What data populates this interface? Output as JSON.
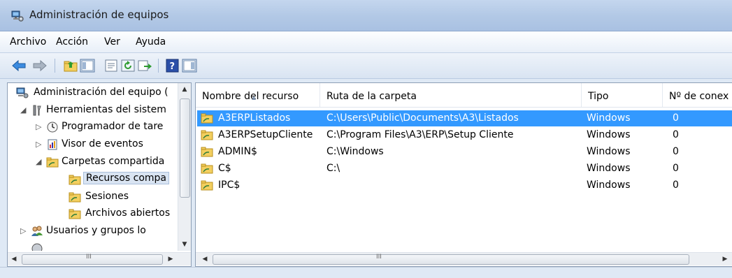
{
  "window": {
    "title": "Administración de equipos"
  },
  "menu": [
    "Archivo",
    "Acción",
    "Ver",
    "Ayuda"
  ],
  "toolbar_icons": [
    "back-arrow-icon",
    "forward-arrow-icon",
    "up-folder-icon",
    "show-hide-tree-icon",
    "properties-icon",
    "refresh-icon",
    "export-list-icon",
    "help-icon",
    "show-hide-action-pane-icon"
  ],
  "tree": {
    "root": "Administración del equipo (",
    "system_tools": "Herramientas del sistem",
    "task_scheduler": "Programador de tare",
    "event_viewer": "Visor de eventos",
    "shared_folders": "Carpetas compartida",
    "shares": "Recursos compa",
    "sessions": "Sesiones",
    "open_files": "Archivos abiertos",
    "local_users": "Usuarios y grupos lo"
  },
  "table": {
    "columns": [
      "Nombre del recurso",
      "Ruta de la carpeta",
      "Tipo",
      "Nº de conex"
    ],
    "rows": [
      {
        "name": "A3ERPListados",
        "path": "C:\\Users\\Public\\Documents\\A3\\Listados",
        "type": "Windows",
        "connections": "0",
        "selected": true
      },
      {
        "name": "A3ERPSetupCliente",
        "path": "C:\\Program Files\\A3\\ERP\\Setup Cliente",
        "type": "Windows",
        "connections": "0",
        "selected": false
      },
      {
        "name": "ADMIN$",
        "path": "C:\\Windows",
        "type": "Windows",
        "connections": "0",
        "selected": false
      },
      {
        "name": "C$",
        "path": "C:\\",
        "type": "Windows",
        "connections": "0",
        "selected": false
      },
      {
        "name": "IPC$",
        "path": "",
        "type": "Windows",
        "connections": "0",
        "selected": false
      }
    ]
  },
  "scroll_grip": "III",
  "colors": {
    "selection": "#3399ff",
    "titlebar": "#b3c9e6"
  }
}
